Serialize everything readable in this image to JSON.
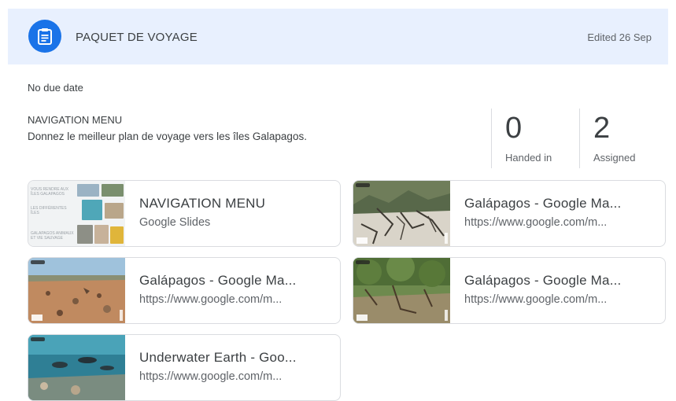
{
  "header": {
    "title": "PAQUET DE VOYAGE",
    "edited": "Edited 26 Sep",
    "icon": "assignment-icon",
    "accent": "#1a73e8"
  },
  "due": "No due date",
  "description": {
    "title": "NAVIGATION MENU",
    "text": "Donnez le meilleur plan de voyage vers les îles Galapagos."
  },
  "stats": [
    {
      "value": "0",
      "label": "Handed in"
    },
    {
      "value": "2",
      "label": "Assigned"
    }
  ],
  "attachments": [
    {
      "title": "NAVIGATION MENU",
      "subtitle": "Google Slides",
      "thumb": "slides"
    },
    {
      "title": "Galápagos - Google Ma...",
      "subtitle": "https://www.google.com/m...",
      "thumb": "rocks"
    },
    {
      "title": "Galápagos - Google Ma...",
      "subtitle": "https://www.google.com/m...",
      "thumb": "beach"
    },
    {
      "title": "Galápagos - Google Ma...",
      "subtitle": "https://www.google.com/m...",
      "thumb": "forest"
    },
    {
      "title": "Underwater Earth - Goo...",
      "subtitle": "https://www.google.com/m...",
      "thumb": "underwater"
    }
  ],
  "slides_thumb_text": {
    "line1": "VOUS RENDRE AUX ÎLES GALAPAGOS",
    "line2": "LES DIFFÉRENTES ÎLES",
    "line3": "GALAPAGOS ANIMAUX ET VIE SAUVAGE"
  }
}
